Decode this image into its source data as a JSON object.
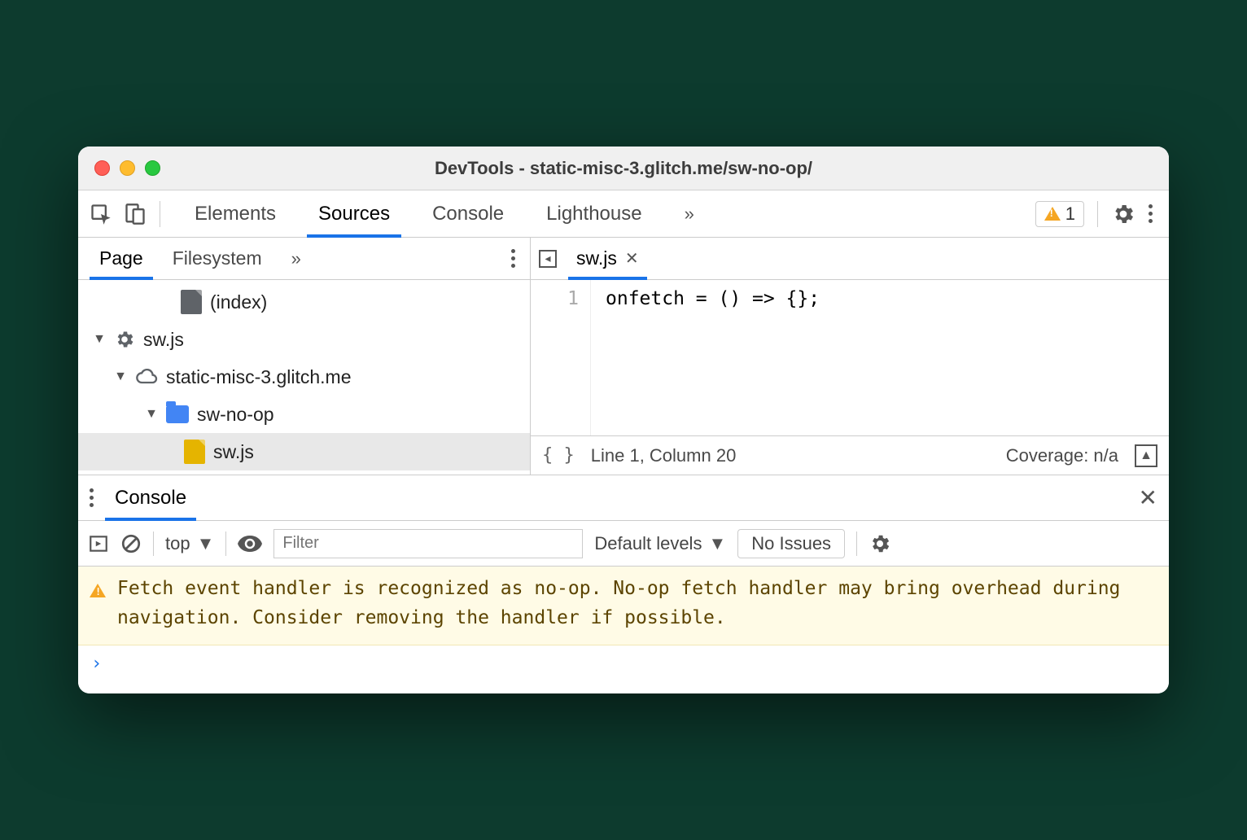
{
  "window": {
    "title": "DevTools - static-misc-3.glitch.me/sw-no-op/"
  },
  "toolbar": {
    "tabs": [
      "Elements",
      "Sources",
      "Console",
      "Lighthouse"
    ],
    "active_tab": "Sources",
    "warnings": "1"
  },
  "sources": {
    "left_tabs": [
      "Page",
      "Filesystem"
    ],
    "active_left_tab": "Page",
    "tree": {
      "index_label": "(index)",
      "sw_root": "sw.js",
      "domain": "static-misc-3.glitch.me",
      "folder": "sw-no-op",
      "file": "sw.js"
    },
    "open_file": "sw.js",
    "code": {
      "line1_num": "1",
      "line1": "onfetch = () => {};"
    },
    "status": {
      "position": "Line 1, Column 20",
      "coverage": "Coverage: n/a"
    }
  },
  "drawer": {
    "tab": "Console",
    "context": "top",
    "filter_placeholder": "Filter",
    "levels": "Default levels",
    "issues_label": "No Issues",
    "warning": "Fetch event handler is recognized as no-op. No-op fetch handler may bring overhead during navigation. Consider removing the handler if possible.",
    "prompt": "›"
  }
}
